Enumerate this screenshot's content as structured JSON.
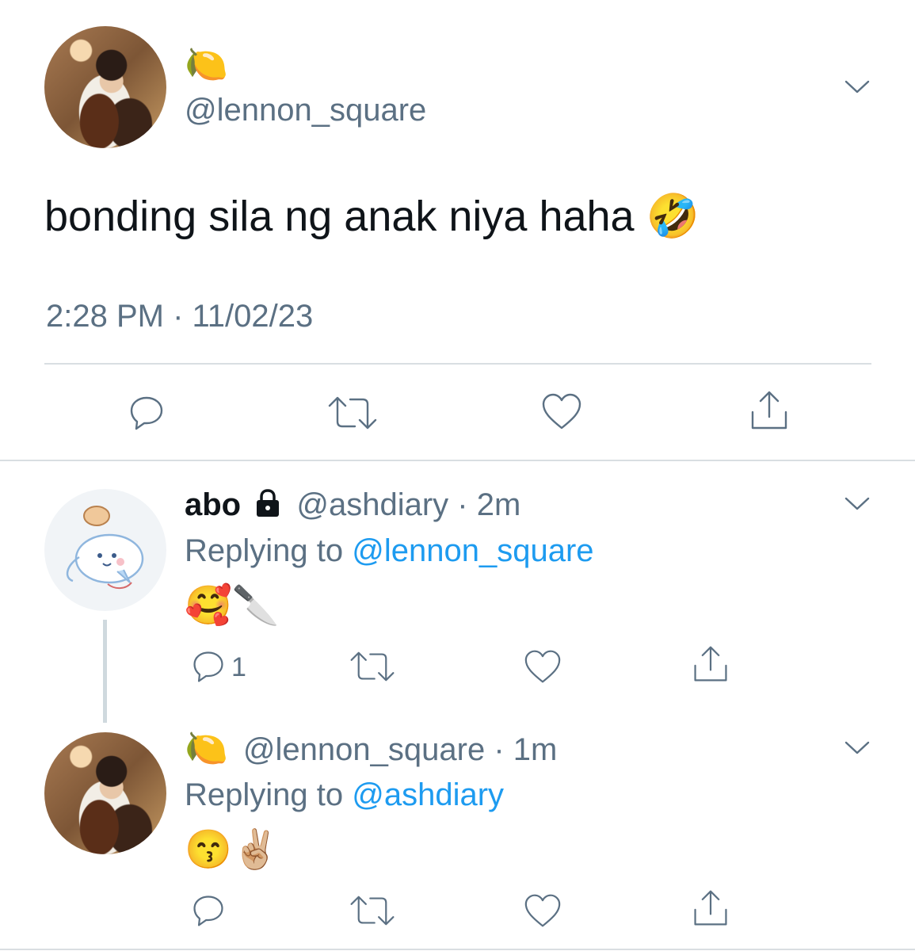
{
  "main_tweet": {
    "display_name": "🍋",
    "handle": "@lennon_square",
    "text": "bonding sila ng anak niya haha 🤣",
    "timestamp": "2:28 PM · 11/02/23"
  },
  "reply1": {
    "display_name": "abo",
    "lock": "🔒",
    "handle": "@ashdiary",
    "time": "· 2m",
    "replying_label": "Replying to",
    "replying_to": "@lennon_square",
    "text": "🥰🔪",
    "reply_count": "1"
  },
  "reply2": {
    "display_name": "🍋",
    "handle": "@lennon_square",
    "time": "· 1m",
    "replying_label": "Replying to",
    "replying_to": "@ashdiary",
    "text": "😙✌🏼"
  },
  "colors": {
    "muted": "#5b7083",
    "link": "#1d9bf0",
    "divider": "#d9dee2"
  },
  "icons": [
    "chevron-down-icon",
    "reply-icon",
    "retweet-icon",
    "like-icon",
    "share-icon",
    "lock-icon"
  ]
}
